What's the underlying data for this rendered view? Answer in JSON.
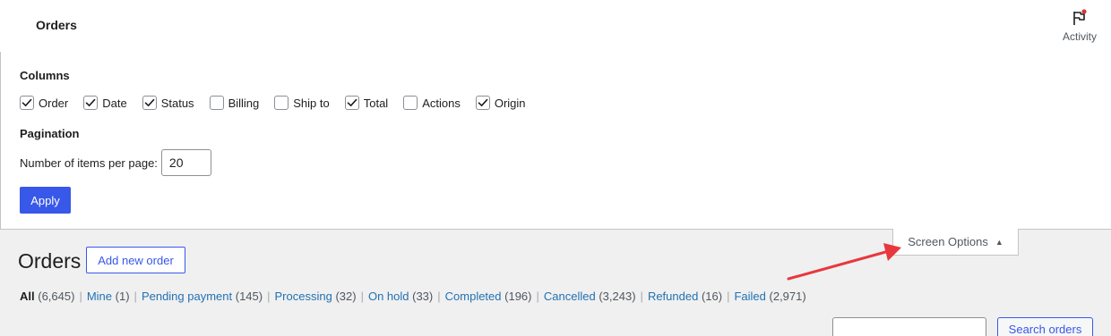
{
  "header": {
    "title": "Orders",
    "activity_label": "Activity",
    "activity_icon": "flag-icon",
    "notification_color": "#d63638"
  },
  "screen_options": {
    "columns_heading": "Columns",
    "columns": [
      {
        "label": "Order",
        "checked": true
      },
      {
        "label": "Date",
        "checked": true
      },
      {
        "label": "Status",
        "checked": true
      },
      {
        "label": "Billing",
        "checked": false
      },
      {
        "label": "Ship to",
        "checked": false
      },
      {
        "label": "Total",
        "checked": true
      },
      {
        "label": "Actions",
        "checked": false
      },
      {
        "label": "Origin",
        "checked": true
      }
    ],
    "pagination_heading": "Pagination",
    "per_page_label": "Number of items per page:",
    "per_page_value": "20",
    "apply_label": "Apply",
    "tab_label": "Screen Options"
  },
  "page": {
    "title": "Orders",
    "add_new_label": "Add new order"
  },
  "filters": [
    {
      "label": "All",
      "count": "(6,645)",
      "current": true
    },
    {
      "label": "Mine",
      "count": "(1)",
      "current": false
    },
    {
      "label": "Pending payment",
      "count": "(145)",
      "current": false
    },
    {
      "label": "Processing",
      "count": "(32)",
      "current": false
    },
    {
      "label": "On hold",
      "count": "(33)",
      "current": false
    },
    {
      "label": "Completed",
      "count": "(196)",
      "current": false
    },
    {
      "label": "Cancelled",
      "count": "(3,243)",
      "current": false
    },
    {
      "label": "Refunded",
      "count": "(16)",
      "current": false
    },
    {
      "label": "Failed",
      "count": "(2,971)",
      "current": false
    }
  ],
  "search": {
    "button_label": "Search orders",
    "value": ""
  },
  "colors": {
    "accent": "#3858e9",
    "link": "#2271b1",
    "annotation_arrow": "#e8383d"
  }
}
